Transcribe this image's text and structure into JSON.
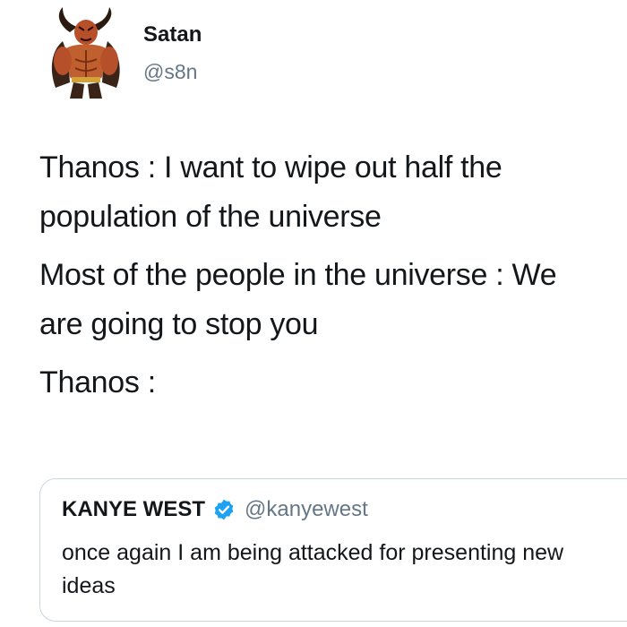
{
  "tweet": {
    "author_name": "Satan",
    "author_handle": "@s8n",
    "paragraphs": [
      "Thanos : I want to wipe out half the population of the universe",
      "Most of the people in the universe : We are going to stop you",
      "Thanos :"
    ]
  },
  "quoted_tweet": {
    "author_name": "KANYE WEST",
    "author_handle": "@kanyewest",
    "verified": true,
    "text": "once again I am being attacked for presenting new ideas"
  },
  "colors": {
    "text_primary": "#14171a",
    "text_secondary": "#657786",
    "verified_blue": "#1da1f2",
    "card_border": "#ccd6dd"
  },
  "icons": {
    "avatar": "devil-avatar",
    "verified": "verified-badge-icon"
  }
}
